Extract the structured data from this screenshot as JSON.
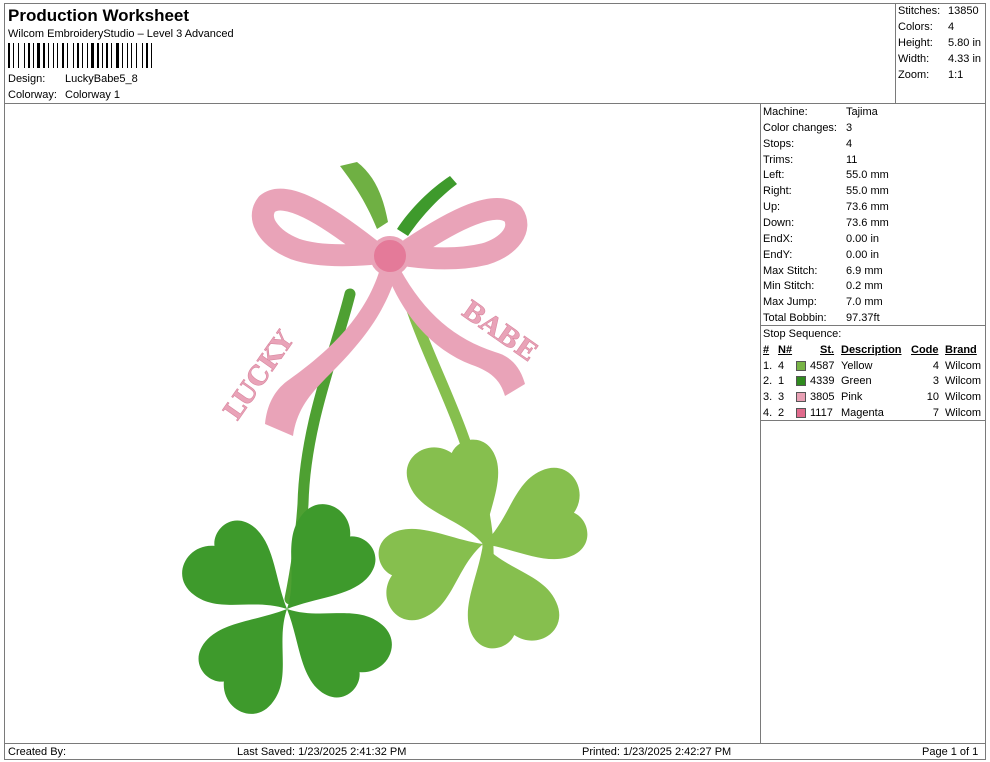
{
  "header": {
    "title": "Production Worksheet",
    "software": "Wilcom EmbroideryStudio – Level 3 Advanced",
    "design_label": "Design:",
    "design_value": "LuckyBabe5_8",
    "colorway_label": "Colorway:",
    "colorway_value": "Colorway 1"
  },
  "summary": [
    {
      "label": "Stitches:",
      "value": "13850"
    },
    {
      "label": "Colors:",
      "value": "4"
    },
    {
      "label": "Height:",
      "value": "5.80 in"
    },
    {
      "label": "Width:",
      "value": "4.33 in"
    },
    {
      "label": "Zoom:",
      "value": "1:1"
    }
  ],
  "machine_info": [
    {
      "label": "Machine:",
      "value": "Tajima"
    },
    {
      "label": "Color changes:",
      "value": "3"
    },
    {
      "label": "Stops:",
      "value": "4"
    },
    {
      "label": "Trims:",
      "value": "11"
    },
    {
      "label": "Left:",
      "value": "55.0 mm"
    },
    {
      "label": "Right:",
      "value": "55.0 mm"
    },
    {
      "label": "Up:",
      "value": "73.6 mm"
    },
    {
      "label": "Down:",
      "value": "73.6 mm"
    },
    {
      "label": "EndX:",
      "value": "0.00 in"
    },
    {
      "label": "EndY:",
      "value": "0.00 in"
    },
    {
      "label": "Max Stitch:",
      "value": "6.9 mm"
    },
    {
      "label": "Min Stitch:",
      "value": "0.2 mm"
    },
    {
      "label": "Max Jump:",
      "value": "7.0 mm"
    },
    {
      "label": "Total Bobbin:",
      "value": "97.37ft"
    }
  ],
  "stop_sequence": {
    "title": "Stop Sequence:",
    "headers": {
      "num": "#",
      "n": "N#",
      "st": "St.",
      "desc": "Description",
      "code": "Code",
      "brand": "Brand"
    },
    "rows": [
      {
        "num": "1.",
        "n": "4",
        "st": "4587",
        "desc": "Yellow",
        "code": "4",
        "brand": "Wilcom",
        "color": "#78b446"
      },
      {
        "num": "2.",
        "n": "1",
        "st": "4339",
        "desc": "Green",
        "code": "3",
        "brand": "Wilcom",
        "color": "#2f8a1e"
      },
      {
        "num": "3.",
        "n": "3",
        "st": "3805",
        "desc": "Pink",
        "code": "10",
        "brand": "Wilcom",
        "color": "#e8a0b4"
      },
      {
        "num": "4.",
        "n": "2",
        "st": "1117",
        "desc": "Magenta",
        "code": "7",
        "brand": "Wilcom",
        "color": "#e06a8c"
      }
    ]
  },
  "design_text": {
    "left": "LUCKY",
    "right": "BABE"
  },
  "colors": {
    "pink": "#e9a3b8",
    "pink_dark": "#d8879f",
    "magenta": "#e47a99",
    "green_dark": "#3e9a2c",
    "green_light": "#86bf4e",
    "border": "#7a7a7a"
  },
  "footer": {
    "created_by": "Created By:",
    "last_saved": "Last Saved: 1/23/2025 2:41:32 PM",
    "printed": "Printed: 1/23/2025 2:42:27 PM",
    "page": "Page 1 of 1"
  }
}
